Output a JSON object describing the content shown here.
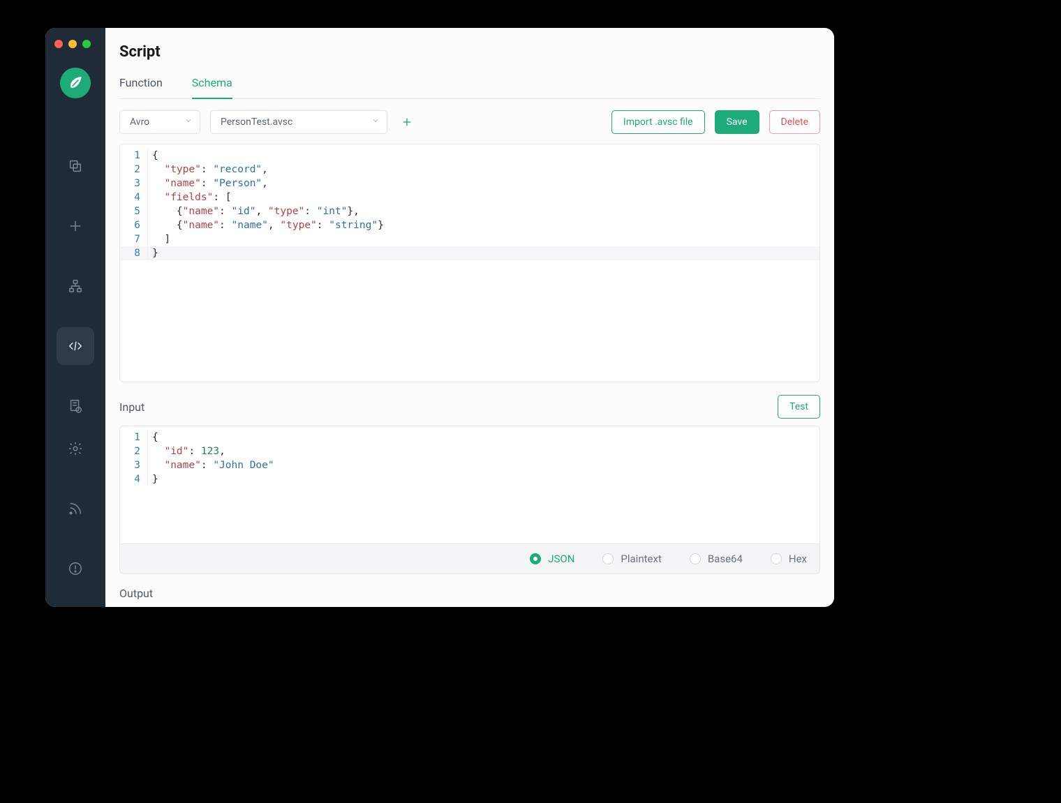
{
  "colors": {
    "accent": "#1dab77",
    "danger": "#e35252",
    "sidebar": "#1f2c37"
  },
  "window": {
    "traffic": [
      "close",
      "minimize",
      "zoom"
    ]
  },
  "sidebar": {
    "logo_icon": "leaf-logo",
    "nav": [
      {
        "icon": "copy-icon",
        "active": false
      },
      {
        "icon": "plus-icon",
        "active": false
      },
      {
        "icon": "tree-icon",
        "active": false
      },
      {
        "icon": "code-icon",
        "active": true
      },
      {
        "icon": "receipt-icon",
        "active": false
      }
    ],
    "bottom": [
      {
        "icon": "gear-icon"
      },
      {
        "icon": "rss-icon"
      },
      {
        "icon": "alert-icon"
      }
    ]
  },
  "header": {
    "title": "Script"
  },
  "tabs": [
    {
      "label": "Function",
      "active": false
    },
    {
      "label": "Schema",
      "active": true
    }
  ],
  "toolbar": {
    "format_select": "Avro",
    "file_select": "PersonTest.avsc",
    "add_icon": "plus-icon",
    "import_label": "Import .avsc file",
    "save_label": "Save",
    "delete_label": "Delete"
  },
  "schema_editor": {
    "lines": [
      [
        {
          "t": "punc",
          "v": "{"
        }
      ],
      [
        {
          "t": "pad",
          "v": "  "
        },
        {
          "t": "key",
          "v": "\"type\""
        },
        {
          "t": "punc",
          "v": ": "
        },
        {
          "t": "str",
          "v": "\"record\""
        },
        {
          "t": "punc",
          "v": ","
        }
      ],
      [
        {
          "t": "pad",
          "v": "  "
        },
        {
          "t": "key",
          "v": "\"name\""
        },
        {
          "t": "punc",
          "v": ": "
        },
        {
          "t": "str",
          "v": "\"Person\""
        },
        {
          "t": "punc",
          "v": ","
        }
      ],
      [
        {
          "t": "pad",
          "v": "  "
        },
        {
          "t": "key",
          "v": "\"fields\""
        },
        {
          "t": "punc",
          "v": ": ["
        }
      ],
      [
        {
          "t": "pad",
          "v": "    "
        },
        {
          "t": "punc",
          "v": "{"
        },
        {
          "t": "key",
          "v": "\"name\""
        },
        {
          "t": "punc",
          "v": ": "
        },
        {
          "t": "str",
          "v": "\"id\""
        },
        {
          "t": "punc",
          "v": ", "
        },
        {
          "t": "key",
          "v": "\"type\""
        },
        {
          "t": "punc",
          "v": ": "
        },
        {
          "t": "str",
          "v": "\"int\""
        },
        {
          "t": "punc",
          "v": "},"
        }
      ],
      [
        {
          "t": "pad",
          "v": "    "
        },
        {
          "t": "punc",
          "v": "{"
        },
        {
          "t": "key",
          "v": "\"name\""
        },
        {
          "t": "punc",
          "v": ": "
        },
        {
          "t": "str",
          "v": "\"name\""
        },
        {
          "t": "punc",
          "v": ", "
        },
        {
          "t": "key",
          "v": "\"type\""
        },
        {
          "t": "punc",
          "v": ": "
        },
        {
          "t": "str",
          "v": "\"string\""
        },
        {
          "t": "punc",
          "v": "}"
        }
      ],
      [
        {
          "t": "pad",
          "v": "  "
        },
        {
          "t": "punc",
          "v": "]"
        }
      ],
      [
        {
          "t": "punc",
          "v": "}"
        }
      ]
    ],
    "cursor_line": 8
  },
  "input": {
    "title": "Input",
    "test_label": "Test",
    "lines": [
      [
        {
          "t": "punc",
          "v": "{"
        }
      ],
      [
        {
          "t": "pad",
          "v": "  "
        },
        {
          "t": "key",
          "v": "\"id\""
        },
        {
          "t": "punc",
          "v": ": "
        },
        {
          "t": "num",
          "v": "123"
        },
        {
          "t": "punc",
          "v": ","
        }
      ],
      [
        {
          "t": "pad",
          "v": "  "
        },
        {
          "t": "key",
          "v": "\"name\""
        },
        {
          "t": "punc",
          "v": ": "
        },
        {
          "t": "str",
          "v": "\"John Doe\""
        }
      ],
      [
        {
          "t": "punc",
          "v": "}"
        }
      ]
    ],
    "format_options": [
      {
        "label": "JSON",
        "selected": true
      },
      {
        "label": "Plaintext",
        "selected": false
      },
      {
        "label": "Base64",
        "selected": false
      },
      {
        "label": "Hex",
        "selected": false
      }
    ]
  },
  "output": {
    "title": "Output"
  }
}
